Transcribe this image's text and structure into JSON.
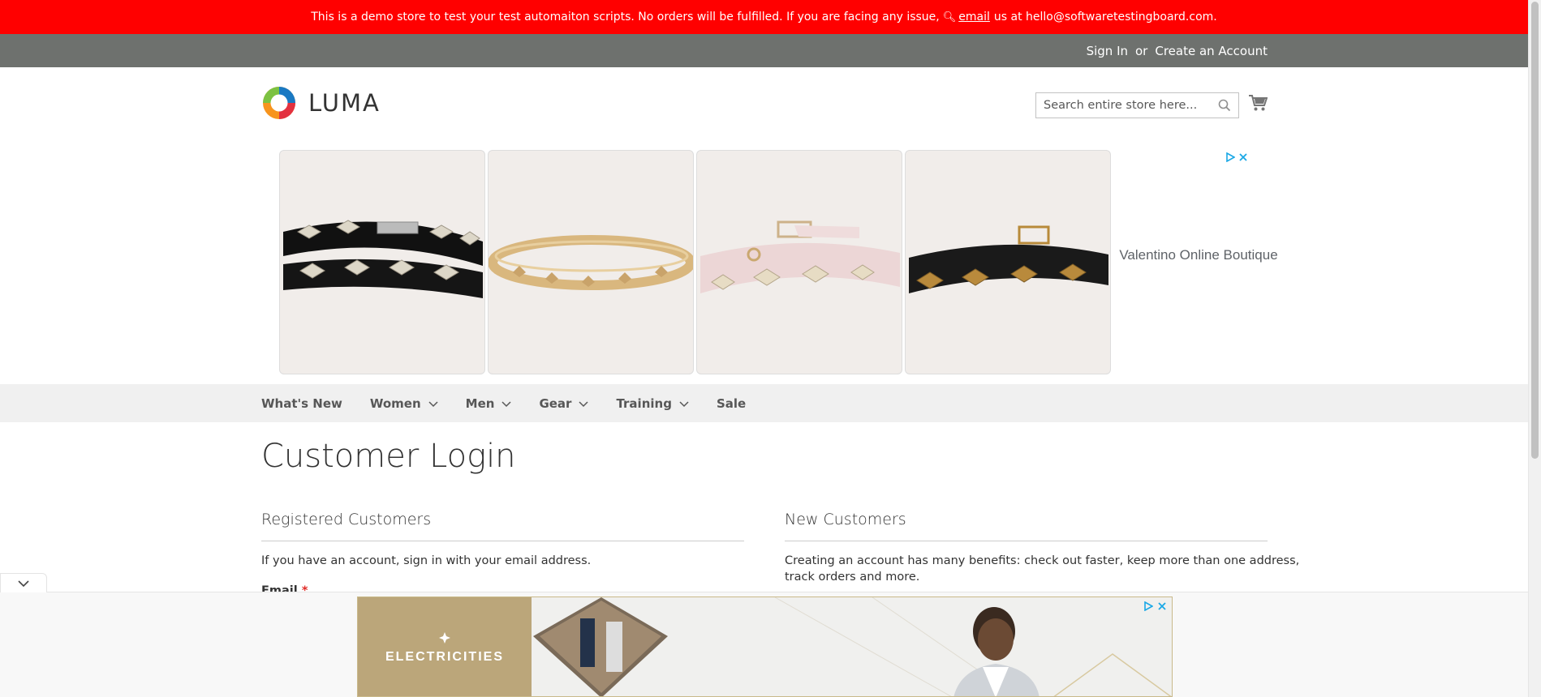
{
  "demo_banner": {
    "text_before": "This is a demo store to test your test automaiton scripts. No orders will be fulfilled. If you are facing any issue,",
    "link_text": "email",
    "text_after": "us at hello@softwaretestingboard.com."
  },
  "header": {
    "sign_in": "Sign In",
    "or": "or",
    "create_account": "Create an Account",
    "logo_text": "LUMA",
    "search_placeholder": "Search entire store here..."
  },
  "ad_top": {
    "side_text": "Valentino Online Boutique",
    "products": [
      "studded black double wrap bracelet",
      "gold studded bangle",
      "pink studded bracelet",
      "black gold studded bracelet"
    ]
  },
  "nav": {
    "items": [
      {
        "label": "What's New",
        "has_dropdown": false
      },
      {
        "label": "Women",
        "has_dropdown": true
      },
      {
        "label": "Men",
        "has_dropdown": true
      },
      {
        "label": "Gear",
        "has_dropdown": true
      },
      {
        "label": "Training",
        "has_dropdown": true
      },
      {
        "label": "Sale",
        "has_dropdown": false
      }
    ]
  },
  "main": {
    "page_title": "Customer Login",
    "registered": {
      "title": "Registered Customers",
      "text": "If you have an account, sign in with your email address.",
      "email_label": "Email",
      "required_mark": "*"
    },
    "new_customers": {
      "title": "New Customers",
      "text_line1": "Creating an account has many benefits: check out faster, keep more than one address,",
      "text_line2": "track orders and more."
    }
  },
  "ad_bottom": {
    "brand": "ELECTRICITIES"
  },
  "colors": {
    "banner": "#ff0000",
    "panel": "#6e716e",
    "nav_bg": "#f0f0f0",
    "required": "#e02b27",
    "ad_choices": "#1aa8e6"
  }
}
